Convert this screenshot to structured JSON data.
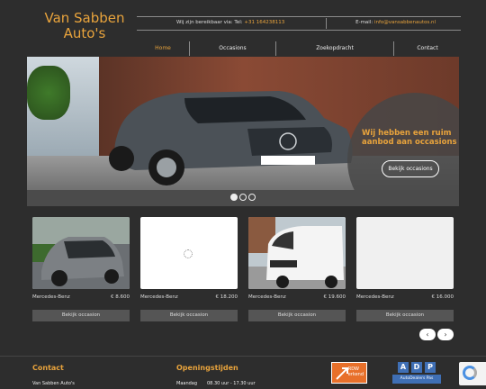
{
  "brand": {
    "name_line1": "Van Sabben",
    "name_line2": "Auto's"
  },
  "contact_bar": {
    "phone_prefix": "Wij zijn bereikbaar via: Tel: ",
    "phone": "+31 164238113",
    "email_prefix": "E-mail: ",
    "email": "info@vansabbenautos.nl"
  },
  "nav": {
    "items": [
      "Home",
      "Occasions",
      "Zoekopdracht",
      "Contact"
    ],
    "active": "Home"
  },
  "hero": {
    "tagline": "Wij hebben een ruim aanbod aan occasions",
    "button": "Bekijk occasions",
    "slide_count": 3,
    "active_slide": 1
  },
  "listings": [
    {
      "name": "Mercedes-Benz",
      "price": "€ 8.600",
      "button": "Bekijk occasion",
      "image": "grey-hatchback"
    },
    {
      "name": "Mercedes-Benz",
      "price": "€ 18.200",
      "button": "Bekijk occasion",
      "image": "loading"
    },
    {
      "name": "Mercedes-Benz",
      "price": "€ 19.600",
      "button": "Bekijk occasion",
      "image": "white-van"
    },
    {
      "name": "Mercedes-Benz",
      "price": "€ 16.000",
      "button": "Bekijk occasion",
      "image": "blank"
    }
  ],
  "carousel_controls": {
    "prev_icon": "chevron-left-icon",
    "next_icon": "chevron-right-icon"
  },
  "footer": {
    "contact_title": "Contact",
    "contact_line": "Van Sabben Auto's",
    "hours_title": "Openingstijden",
    "hours_day": "Maandag",
    "hours_time": "08.30 uur - 17.30 uur",
    "rdw_label": "RDW",
    "rdw_sub": "erkend",
    "adp_letters": [
      "A",
      "D",
      "P"
    ],
    "adp_label": "AutoDealers Pas"
  },
  "colors": {
    "accent": "#e8a33c",
    "background": "#2d2d2d",
    "button": "#555555"
  }
}
